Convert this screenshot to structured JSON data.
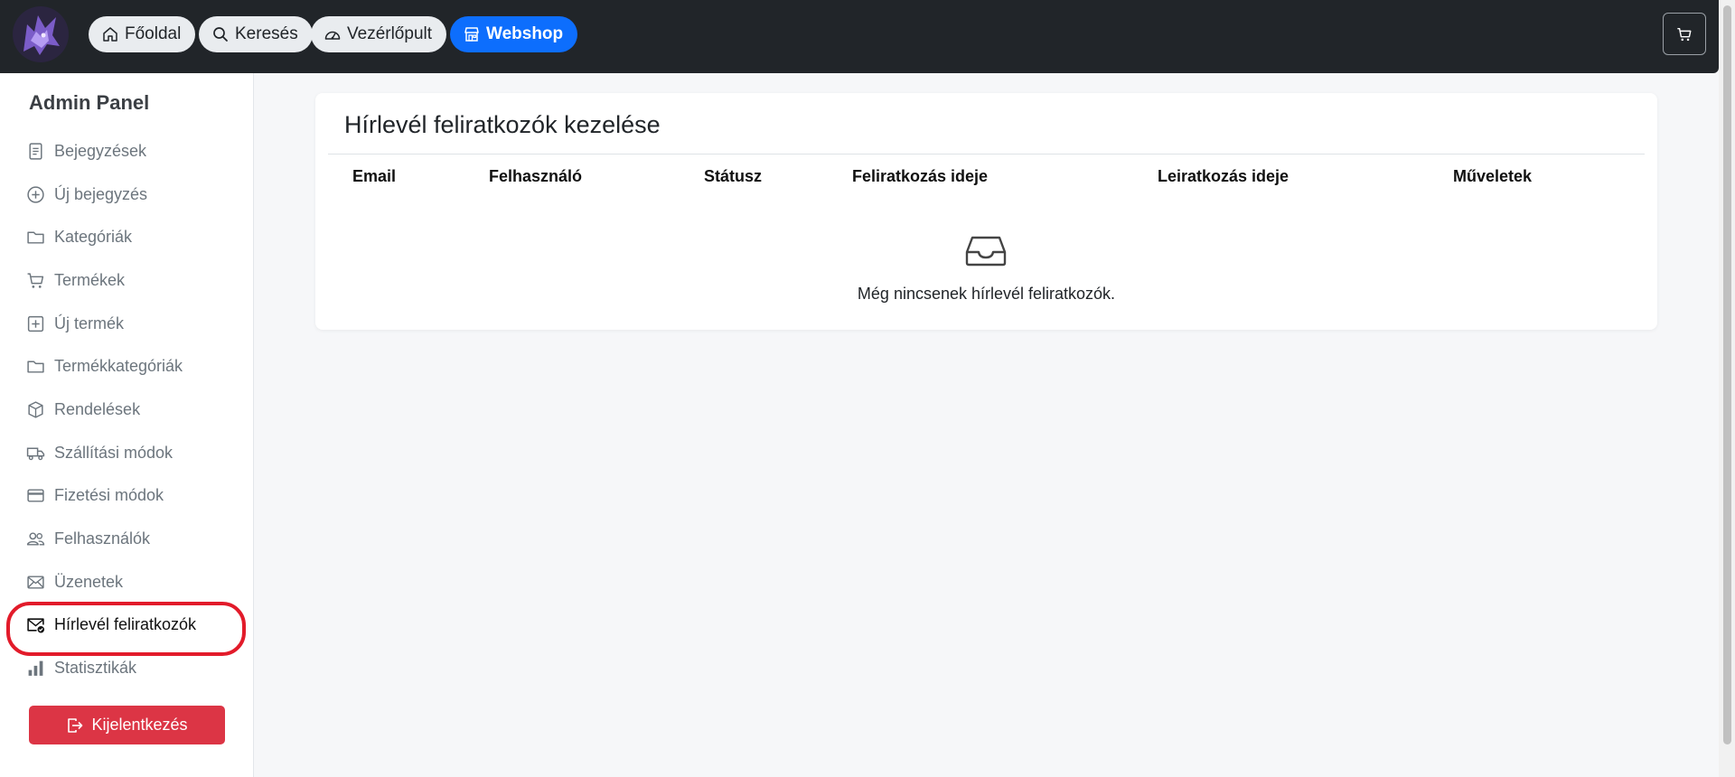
{
  "nav": {
    "home_label": "Főoldal",
    "search_label": "Keresés",
    "dashboard_label": "Vezérlőpult",
    "webshop_label": "Webshop",
    "accent_color": "#0d6efd",
    "icons": [
      "home-icon",
      "search-icon",
      "speedometer-icon",
      "shop-icon",
      "cart-icon"
    ]
  },
  "sidebar": {
    "title": "Admin Panel",
    "items": [
      {
        "label": "Bejegyzések",
        "icon": "file-text-icon"
      },
      {
        "label": "Új bejegyzés",
        "icon": "plus-circle-icon"
      },
      {
        "label": "Kategóriák",
        "icon": "folder-icon"
      },
      {
        "label": "Termékek",
        "icon": "cart-icon"
      },
      {
        "label": "Új termék",
        "icon": "plus-square-icon"
      },
      {
        "label": "Termékkategóriák",
        "icon": "folder-icon"
      },
      {
        "label": "Rendelések",
        "icon": "box-icon"
      },
      {
        "label": "Szállítási módok",
        "icon": "truck-icon"
      },
      {
        "label": "Fizetési módok",
        "icon": "credit-card-icon"
      },
      {
        "label": "Felhasználók",
        "icon": "people-icon"
      },
      {
        "label": "Üzenetek",
        "icon": "envelope-icon"
      },
      {
        "label": "Hírlevél feliratkozók",
        "icon": "envelope-check-icon",
        "active": true
      },
      {
        "label": "Statisztikák",
        "icon": "bar-chart-icon"
      }
    ],
    "logout_label": "Kijelentkezés",
    "logout_color": "#dc3545",
    "highlight_color": "#e21b2a"
  },
  "main": {
    "title": "Hírlevél feliratkozók kezelése",
    "columns": [
      "Email",
      "Felhasználó",
      "Státusz",
      "Feliratkozás ideje",
      "Leiratkozás ideje",
      "Műveletek"
    ],
    "empty_message": "Még nincsenek hírlevél feliratkozók.",
    "empty_icon": "inbox-icon"
  }
}
